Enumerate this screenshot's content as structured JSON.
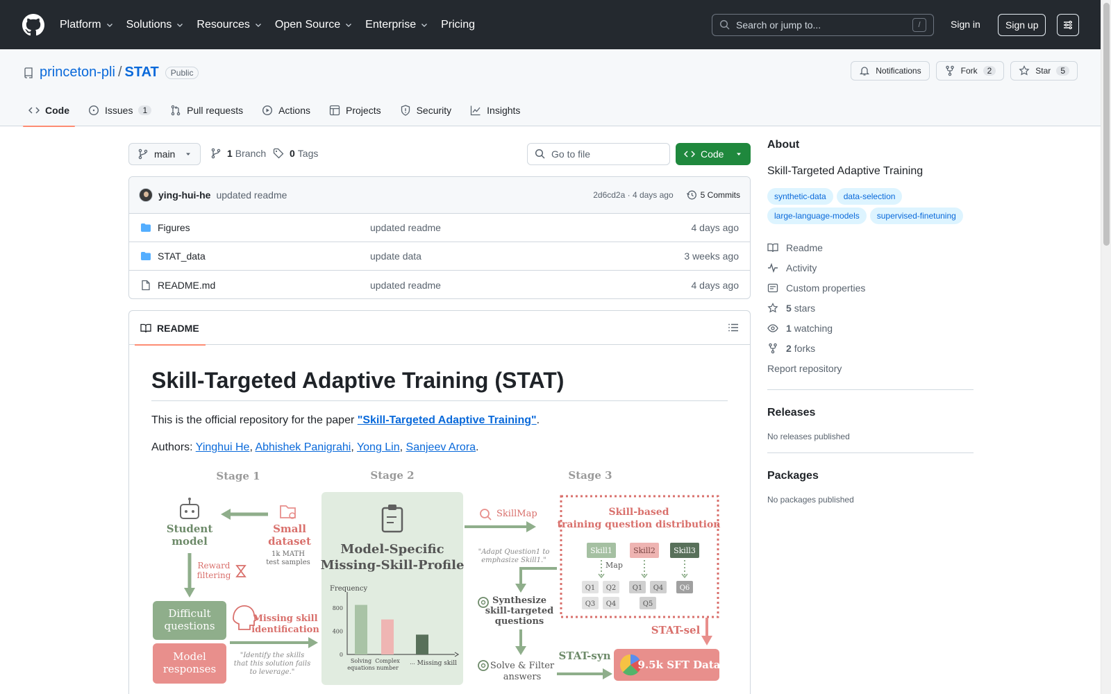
{
  "header": {
    "nav": [
      "Platform",
      "Solutions",
      "Resources",
      "Open Source",
      "Enterprise",
      "Pricing"
    ],
    "search_placeholder": "Search or jump to...",
    "search_shortcut": "/",
    "sign_in": "Sign in",
    "sign_up": "Sign up"
  },
  "repo": {
    "owner": "princeton-pli",
    "separator": "/",
    "name": "STAT",
    "visibility": "Public",
    "notifications_label": "Notifications",
    "fork_label": "Fork",
    "fork_count": "2",
    "star_label": "Star",
    "star_count": "5",
    "tabs": [
      {
        "label": "Code"
      },
      {
        "label": "Issues",
        "count": "1"
      },
      {
        "label": "Pull requests"
      },
      {
        "label": "Actions"
      },
      {
        "label": "Projects"
      },
      {
        "label": "Security"
      },
      {
        "label": "Insights"
      }
    ]
  },
  "files": {
    "branch": "main",
    "branch_count": "1",
    "branch_label": "Branch",
    "tag_count": "0",
    "tag_label": "Tags",
    "goto_placeholder": "Go to file",
    "code_button": "Code",
    "latest_commit": {
      "author": "ying-hui-he",
      "message": "updated readme",
      "hash_time": "2d6cd2a · 4 days ago",
      "commits": "5 Commits"
    },
    "rows": [
      {
        "name": "Figures",
        "message": "updated readme",
        "date": "4 days ago"
      },
      {
        "name": "STAT_data",
        "message": "update data",
        "date": "3 weeks ago"
      },
      {
        "name": "README.md",
        "message": "updated readme",
        "date": "4 days ago"
      }
    ]
  },
  "readme": {
    "tab": "README",
    "title": "Skill-Targeted Adaptive Training (STAT)",
    "intro_prefix": "This is the official repository for the paper ",
    "paper_link": "\"Skill-Targeted Adaptive Training\"",
    "intro_suffix": ".",
    "authors_prefix": "Authors: ",
    "authors": [
      "Yinghui He",
      "Abhishek Panigrahi",
      "Yong Lin",
      "Sanjeev Arora"
    ],
    "figure": {
      "stage1": "Stage 1",
      "stage2": "Stage 2",
      "stage3": "Stage 3",
      "student_model_1": "Student",
      "student_model_2": "model",
      "small_dataset_1": "Small",
      "small_dataset_2": "dataset",
      "math_samples_1": "1k MATH",
      "math_samples_2": "test samples",
      "reward_filtering_1": "Reward",
      "reward_filtering_2": "filtering",
      "difficult_1": "Difficult",
      "difficult_2": "questions",
      "model_resp_1": "Model",
      "model_resp_2": "responses",
      "missing_skill_1": "Missing skill",
      "missing_skill_2": "identification",
      "identify_quote_1": "\"Identify the skills",
      "identify_quote_2": "that this solution fails",
      "identify_quote_3": "to leverage.\"",
      "profile_1": "Model-Specific",
      "profile_2": "Missing-Skill-Profile",
      "freq_label": "Frequency",
      "skillmap": "SkillMap",
      "adapt_quote_1": "\"Adapt Question1 to",
      "adapt_quote_2": "emphasize Skill1.\"",
      "synth_1": "Synthesize",
      "synth_2": "skill-targeted",
      "synth_3": "questions",
      "solve_1": "Solve & Filter",
      "solve_2": "answers",
      "dist_1": "Skill-based",
      "dist_2": "training question distribution",
      "skill1": "Skill1",
      "skill2": "Skill2",
      "skill3": "Skill3",
      "map": "Map",
      "q1": "Q1",
      "q2": "Q2",
      "q3": "Q3",
      "q4": "Q4",
      "q5": "Q5",
      "q6": "Q6",
      "stat_sel": "STAT-sel",
      "stat_syn": "STAT-syn",
      "sft": "9.5k SFT Data"
    }
  },
  "chart_data": {
    "type": "bar",
    "categories": [
      "Solving equations",
      "Complex number",
      "...",
      "Missing skill"
    ],
    "values": [
      850,
      600,
      null,
      340
    ],
    "ylabel": "Frequency",
    "xlabel": "Missing skill",
    "yticks": [
      0,
      400,
      800
    ],
    "ylim": [
      0,
      1000
    ]
  },
  "about": {
    "heading": "About",
    "description": "Skill-Targeted Adaptive Training",
    "topics": [
      "synthetic-data",
      "data-selection",
      "large-language-models",
      "supervised-finetuning"
    ],
    "readme": "Readme",
    "activity": "Activity",
    "custom_properties": "Custom properties",
    "stars_count": "5",
    "stars_label": "stars",
    "watching_count": "1",
    "watching_label": "watching",
    "forks_count": "2",
    "forks_label": "forks",
    "report": "Report repository",
    "releases_heading": "Releases",
    "releases_text": "No releases published",
    "packages_heading": "Packages",
    "packages_text": "No packages published"
  },
  "colors": {
    "header_bg": "#24292f",
    "link": "#0969da",
    "primary_button": "#1f883d",
    "tab_underline": "#fd8c73",
    "fig_green": "#8fae8b",
    "fig_red": "#e88f8c"
  }
}
